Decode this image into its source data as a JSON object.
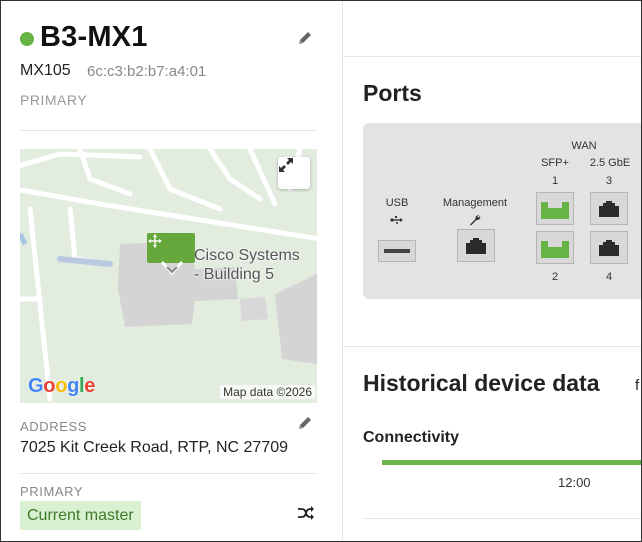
{
  "device": {
    "name": "B3-MX1",
    "status_color": "#67b346",
    "model": "MX105",
    "mac": "6c:c3:b2:b7:a4:01",
    "role": "PRIMARY",
    "edit_icon": "pencil-icon"
  },
  "map": {
    "place_label_line1": "Cisco Systems",
    "place_label_line2": "- Building 5",
    "attribution": "Google",
    "map_data": "Map data ©2026",
    "expand_icon": "expand-arrows-icon",
    "pin_icon": "move-arrows-icon"
  },
  "address": {
    "label": "ADDRESS",
    "value": "7025 Kit Creek Road, RTP, NC 27709"
  },
  "primary": {
    "label": "PRIMARY",
    "badge": "Current master",
    "badge_color": "#d9f0d1",
    "swap_icon": "shuffle-icon"
  },
  "ports": {
    "title": "Ports",
    "usb_label": "USB",
    "management_label": "Management",
    "wan_label": "WAN",
    "sfp_label": "SFP+",
    "gbe_label": "2.5 GbE",
    "port_numbers": [
      "1",
      "3",
      "2",
      "4"
    ],
    "active_color": "#67b346"
  },
  "history": {
    "title": "Historical device data",
    "extra": "f",
    "connectivity_label": "Connectivity",
    "time_tick": "12:00",
    "bar_color": "#6cb34e"
  }
}
